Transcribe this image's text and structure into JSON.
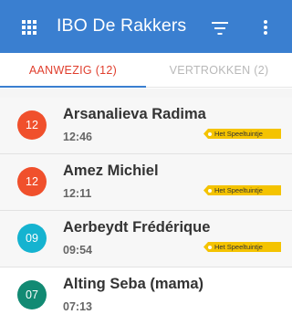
{
  "app": {
    "title": "IBO De Rakkers"
  },
  "icons": {
    "menu": "grid-icon",
    "filter": "filter-icon",
    "more": "more-vertical-icon"
  },
  "colors": {
    "primary": "#3a7fd0",
    "active_tab": "#e03e2d",
    "badge": "#f4c300"
  },
  "tabs": [
    {
      "label": "AANWEZIG (12)",
      "active": true
    },
    {
      "label": "VERTROKKEN (2)",
      "active": false
    }
  ],
  "children": [
    {
      "initials": "12",
      "avatar_color": "#f0502c",
      "name": "Arsanalieva Radima",
      "time": "12:46",
      "badge": "Het Speeltuintje"
    },
    {
      "initials": "12",
      "avatar_color": "#f0502c",
      "name": "Amez Michiel",
      "time": "12:11",
      "badge": "Het Speeltuintje"
    },
    {
      "initials": "09",
      "avatar_color": "#15b3d0",
      "name": "Aerbeydt Frédérique",
      "time": "09:54",
      "badge": "Het Speeltuintje"
    },
    {
      "initials": "07",
      "avatar_color": "#128a73",
      "name": "Alting Seba (mama)",
      "time": "07:13",
      "badge": ""
    }
  ]
}
